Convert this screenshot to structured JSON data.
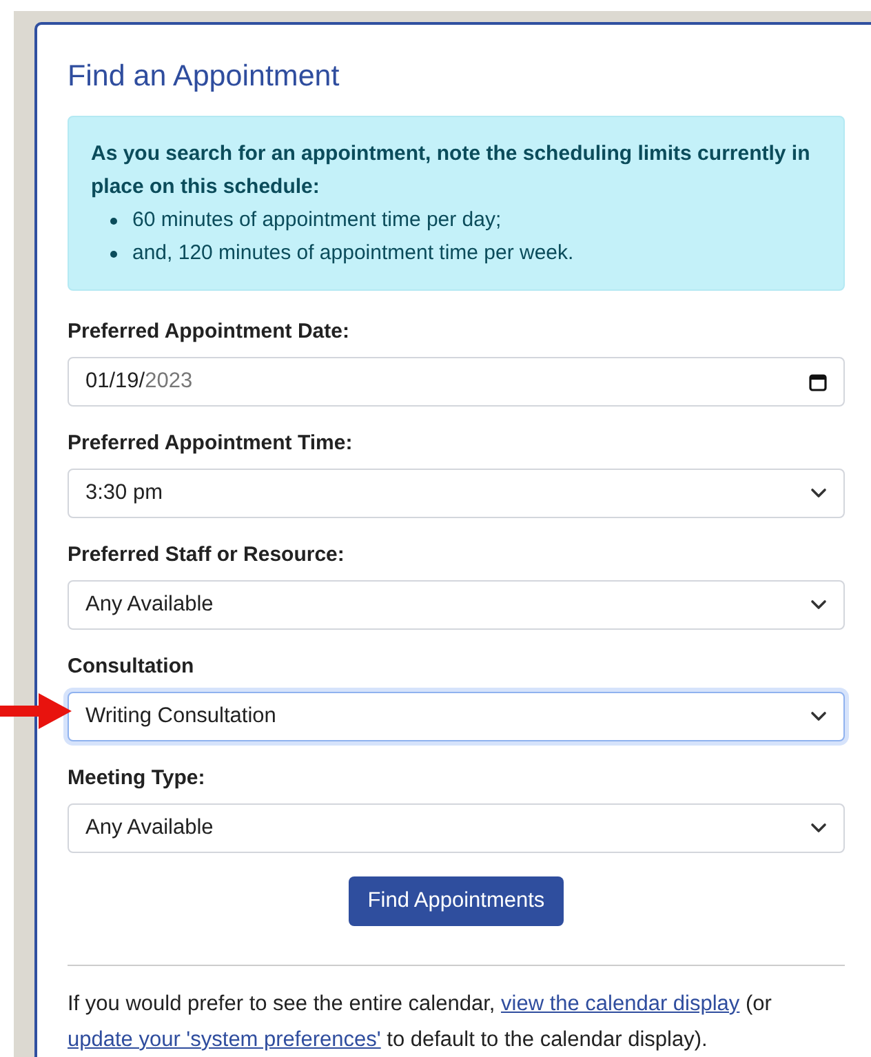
{
  "title": "Find an Appointment",
  "notice": {
    "heading": "As you search for an appointment, note the scheduling limits currently in place on this schedule:",
    "items": [
      "60 minutes of appointment time per day;",
      "and, 120 minutes of appointment time per week."
    ]
  },
  "fields": [
    {
      "kind": "date",
      "label": "Preferred Appointment Date:",
      "value": "01/19/",
      "value_dimmed": "2023",
      "focused": false
    },
    {
      "kind": "select",
      "label": "Preferred Appointment Time:",
      "value": "3:30 pm",
      "focused": false
    },
    {
      "kind": "select",
      "label": "Preferred Staff or Resource:",
      "value": "Any Available",
      "focused": false
    },
    {
      "kind": "select",
      "label": "Consultation",
      "value": "Writing Consultation",
      "focused": true
    },
    {
      "kind": "select",
      "label": "Meeting Type:",
      "value": "Any Available",
      "focused": false
    }
  ],
  "submit_button": "Find Appointments",
  "footer": [
    {
      "kind": "text",
      "text": "If you would prefer to see the entire calendar, "
    },
    {
      "kind": "link",
      "text": "view the calendar display"
    },
    {
      "kind": "text",
      "text": " (or "
    },
    {
      "kind": "link",
      "text": "update your 'system preferences'"
    },
    {
      "kind": "text",
      "text": " to default to the calendar display)."
    }
  ],
  "annotation": {
    "kind": "arrow"
  }
}
